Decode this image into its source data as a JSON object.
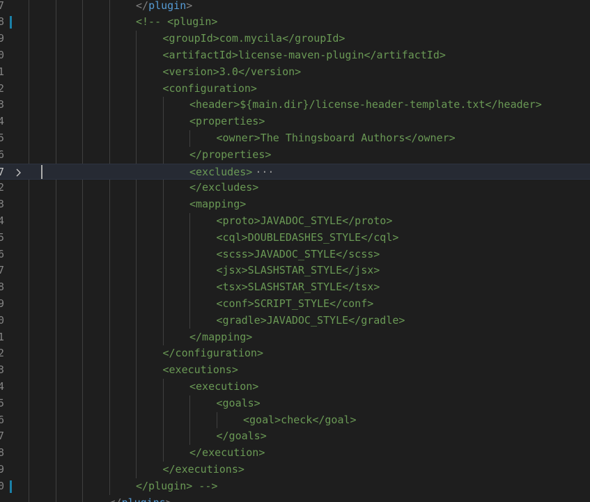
{
  "editor": {
    "lines": [
      {
        "ln": "7",
        "indent": 4,
        "kind": "plain",
        "text": "</plugin>"
      },
      {
        "ln": "8",
        "indent": 4,
        "kind": "comment",
        "modified": true,
        "text": "<!-- <plugin>"
      },
      {
        "ln": "9",
        "indent": 5,
        "kind": "comment",
        "text": "<groupId>com.mycila</groupId>"
      },
      {
        "ln": "0",
        "indent": 5,
        "kind": "comment",
        "text": "<artifactId>license-maven-plugin</artifactId>"
      },
      {
        "ln": "1",
        "indent": 5,
        "kind": "comment",
        "text": "<version>3.0</version>"
      },
      {
        "ln": "2",
        "indent": 5,
        "kind": "comment",
        "text": "<configuration>"
      },
      {
        "ln": "3",
        "indent": 6,
        "kind": "comment",
        "text": "<header>${main.dir}/license-header-template.txt</header>"
      },
      {
        "ln": "4",
        "indent": 6,
        "kind": "comment",
        "text": "<properties>"
      },
      {
        "ln": "5",
        "indent": 7,
        "kind": "comment",
        "text": "<owner>The Thingsboard Authors</owner>"
      },
      {
        "ln": "6",
        "indent": 6,
        "kind": "comment",
        "text": "</properties>"
      },
      {
        "ln": "7",
        "indent": 6,
        "kind": "comment",
        "current": true,
        "folded": true,
        "text": "<excludes>",
        "ellipsis": "···"
      },
      {
        "ln": "2",
        "indent": 6,
        "kind": "comment",
        "text": "</excludes>"
      },
      {
        "ln": "3",
        "indent": 6,
        "kind": "comment",
        "text": "<mapping>"
      },
      {
        "ln": "4",
        "indent": 7,
        "kind": "comment",
        "text": "<proto>JAVADOC_STYLE</proto>"
      },
      {
        "ln": "5",
        "indent": 7,
        "kind": "comment",
        "text": "<cql>DOUBLEDASHES_STYLE</cql>"
      },
      {
        "ln": "6",
        "indent": 7,
        "kind": "comment",
        "text": "<scss>JAVADOC_STYLE</scss>"
      },
      {
        "ln": "7",
        "indent": 7,
        "kind": "comment",
        "text": "<jsx>SLASHSTAR_STYLE</jsx>"
      },
      {
        "ln": "8",
        "indent": 7,
        "kind": "comment",
        "text": "<tsx>SLASHSTAR_STYLE</tsx>"
      },
      {
        "ln": "9",
        "indent": 7,
        "kind": "comment",
        "text": "<conf>SCRIPT_STYLE</conf>"
      },
      {
        "ln": "0",
        "indent": 7,
        "kind": "comment",
        "text": "<gradle>JAVADOC_STYLE</gradle>"
      },
      {
        "ln": "1",
        "indent": 6,
        "kind": "comment",
        "text": "</mapping>"
      },
      {
        "ln": "2",
        "indent": 5,
        "kind": "comment",
        "text": "</configuration>"
      },
      {
        "ln": "3",
        "indent": 5,
        "kind": "comment",
        "text": "<executions>"
      },
      {
        "ln": "4",
        "indent": 6,
        "kind": "comment",
        "text": "<execution>"
      },
      {
        "ln": "5",
        "indent": 7,
        "kind": "comment",
        "text": "<goals>"
      },
      {
        "ln": "6",
        "indent": 8,
        "kind": "comment",
        "text": "<goal>check</goal>"
      },
      {
        "ln": "7",
        "indent": 7,
        "kind": "comment",
        "text": "</goals>"
      },
      {
        "ln": "8",
        "indent": 6,
        "kind": "comment",
        "text": "</execution>"
      },
      {
        "ln": "9",
        "indent": 5,
        "kind": "comment",
        "text": "</executions>"
      },
      {
        "ln": "0",
        "indent": 4,
        "kind": "comment",
        "modified": true,
        "text": "</plugin> -->"
      },
      {
        "ln": "",
        "indent": 3,
        "kind": "plain",
        "text": "</plugins>"
      }
    ]
  },
  "colors": {
    "background": "#1e1e1e",
    "comment": "#6a9955",
    "tag": "#569cd6",
    "text": "#d4d4d4",
    "modified_gutter": "#1b81a8",
    "current_line": "#262a33"
  },
  "icons": {
    "fold": "chevron-right-icon"
  }
}
